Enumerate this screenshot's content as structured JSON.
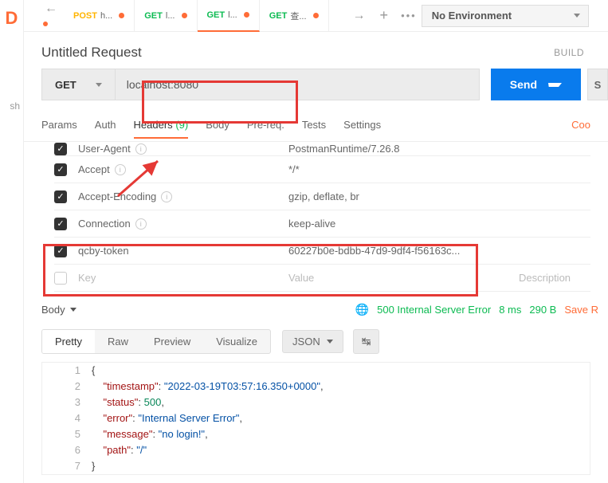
{
  "environment": {
    "selected": "No Environment"
  },
  "tabs": [
    {
      "method": "POST",
      "method_class": "post",
      "name": "h..."
    },
    {
      "method": "GET",
      "method_class": "get",
      "name": "l..."
    },
    {
      "method": "GET",
      "method_class": "get",
      "name": "l...",
      "active": true
    },
    {
      "method": "GET",
      "method_class": "get",
      "name": "查..."
    }
  ],
  "request": {
    "title": "Untitled Request",
    "build": "BUILD",
    "method": "GET",
    "url": "localhost:8080",
    "send": "Send",
    "save_stub": "S"
  },
  "req_tabs": {
    "params": "Params",
    "auth": "Auth",
    "headers": "Headers",
    "headers_count": "(9)",
    "body": "Body",
    "prereq": "Pre-req.",
    "tests": "Tests",
    "settings": "Settings",
    "cookies": "Coo"
  },
  "headers": [
    {
      "key": "User-Agent",
      "value": "PostmanRuntime/7.26.8",
      "info": true,
      "cut": true
    },
    {
      "key": "Accept",
      "value": "*/*",
      "info": true
    },
    {
      "key": "Accept-Encoding",
      "value": "gzip, deflate, br",
      "info": true
    },
    {
      "key": "Connection",
      "value": "keep-alive",
      "info": true
    },
    {
      "key": "qcby-token",
      "value": "60227b0e-bdbb-47d9-9df4-f56163c...",
      "info": false
    }
  ],
  "header_placeholder": {
    "key": "Key",
    "value": "Value",
    "desc": "Description"
  },
  "response": {
    "body_tab": "Body",
    "status": "500 Internal Server Error",
    "time": "8 ms",
    "size": "290 B",
    "save": "Save R"
  },
  "view": {
    "pretty": "Pretty",
    "raw": "Raw",
    "preview": "Preview",
    "visualize": "Visualize",
    "lang": "JSON"
  },
  "code": [
    {
      "n": 1,
      "tokens": [
        {
          "c": "pun",
          "t": "{"
        }
      ]
    },
    {
      "n": 2,
      "tokens": [
        {
          "c": "ind",
          "t": "    "
        },
        {
          "c": "key",
          "t": "\"timestamp\""
        },
        {
          "c": "pun",
          "t": ": "
        },
        {
          "c": "str",
          "t": "\"2022-03-19T03:57:16.350+0000\""
        },
        {
          "c": "pun",
          "t": ","
        }
      ]
    },
    {
      "n": 3,
      "tokens": [
        {
          "c": "ind",
          "t": "    "
        },
        {
          "c": "key",
          "t": "\"status\""
        },
        {
          "c": "pun",
          "t": ": "
        },
        {
          "c": "num",
          "t": "500"
        },
        {
          "c": "pun",
          "t": ","
        }
      ]
    },
    {
      "n": 4,
      "tokens": [
        {
          "c": "ind",
          "t": "    "
        },
        {
          "c": "key",
          "t": "\"error\""
        },
        {
          "c": "pun",
          "t": ": "
        },
        {
          "c": "str",
          "t": "\"Internal Server Error\""
        },
        {
          "c": "pun",
          "t": ","
        }
      ]
    },
    {
      "n": 5,
      "tokens": [
        {
          "c": "ind",
          "t": "    "
        },
        {
          "c": "key",
          "t": "\"message\""
        },
        {
          "c": "pun",
          "t": ": "
        },
        {
          "c": "str",
          "t": "\"no login!\""
        },
        {
          "c": "pun",
          "t": ","
        }
      ]
    },
    {
      "n": 6,
      "tokens": [
        {
          "c": "ind",
          "t": "    "
        },
        {
          "c": "key",
          "t": "\"path\""
        },
        {
          "c": "pun",
          "t": ": "
        },
        {
          "c": "str",
          "t": "\"/\""
        }
      ]
    },
    {
      "n": 7,
      "tokens": [
        {
          "c": "pun",
          "t": "}"
        }
      ]
    }
  ]
}
